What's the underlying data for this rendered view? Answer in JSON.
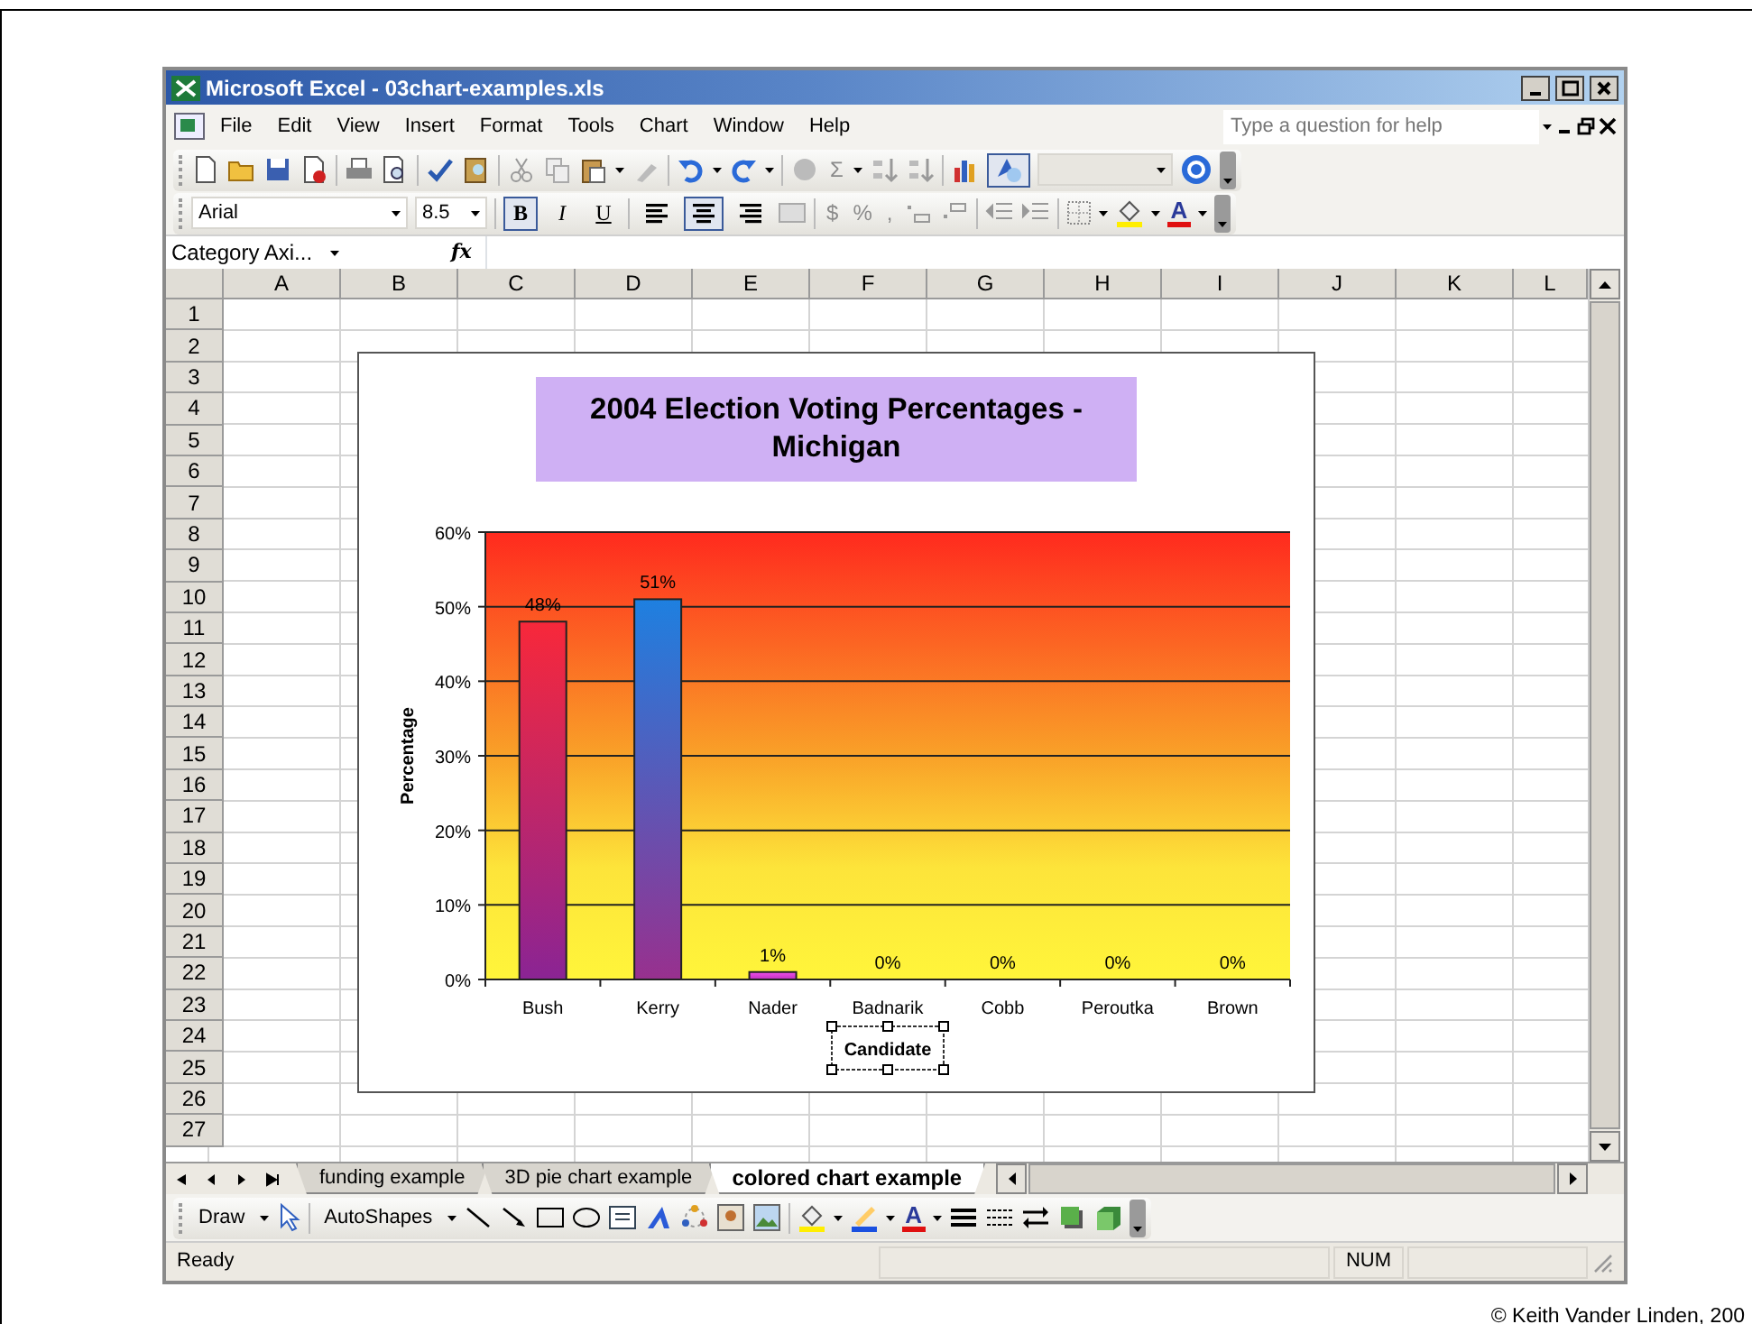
{
  "window": {
    "title": "Microsoft Excel - 03chart-examples.xls"
  },
  "menu": [
    {
      "label": "File"
    },
    {
      "label": "Edit"
    },
    {
      "label": "View"
    },
    {
      "label": "Insert"
    },
    {
      "label": "Format"
    },
    {
      "label": "Tools"
    },
    {
      "label": "Chart"
    },
    {
      "label": "Window"
    },
    {
      "label": "Help"
    }
  ],
  "help_search": {
    "placeholder": "Type a question for help"
  },
  "standard_toolbar": {
    "autosum": "Σ",
    "drawing_pressed": true
  },
  "formatting_toolbar": {
    "font": "Arial",
    "size": "8.5",
    "styles": [
      {
        "label": "B",
        "pressed": true
      },
      {
        "label": "I",
        "pressed": false
      },
      {
        "label": "U",
        "pressed": false
      }
    ],
    "alignment": [
      {
        "kind": "left",
        "pressed": false
      },
      {
        "kind": "center",
        "pressed": true
      },
      {
        "kind": "right",
        "pressed": false
      }
    ],
    "number_formats": [
      "$",
      "%",
      ","
    ],
    "font_color_glyph": "A"
  },
  "formula_bar": {
    "name_box": "Category Axi...",
    "function_label": "fx"
  },
  "sheet": {
    "columns": [
      "A",
      "B",
      "C",
      "D",
      "E",
      "F",
      "G",
      "H",
      "I",
      "J",
      "K",
      "L"
    ],
    "rows": [
      "1",
      "2",
      "3",
      "4",
      "5",
      "6",
      "7",
      "8",
      "9",
      "10",
      "11",
      "12",
      "13",
      "14",
      "15",
      "16",
      "17",
      "18",
      "19",
      "20",
      "21",
      "22",
      "23",
      "24",
      "25",
      "26",
      "27"
    ]
  },
  "chart": {
    "chart_data": {
      "type": "bar",
      "title": "2004 Election Voting Percentages - Michigan",
      "xlabel": "Candidate",
      "ylabel": "Percentage",
      "categories": [
        "Bush",
        "Kerry",
        "Nader",
        "Badnarik",
        "Cobb",
        "Peroutka",
        "Brown"
      ],
      "values": [
        48,
        51,
        1,
        0,
        0,
        0,
        0
      ],
      "ylim": [
        0,
        60
      ],
      "grid": true,
      "yticks": [
        {
          "value": 0,
          "label": "0%"
        },
        {
          "value": 10,
          "label": "10%"
        },
        {
          "value": 20,
          "label": "20%"
        },
        {
          "value": 30,
          "label": "30%"
        },
        {
          "value": 40,
          "label": "40%"
        },
        {
          "value": 50,
          "label": "50%"
        },
        {
          "value": 60,
          "label": "60%"
        }
      ],
      "value_labels": [
        "48%",
        "51%",
        "1%",
        "0%",
        "0%",
        "0%",
        "0%"
      ]
    },
    "xlabel_selected": true
  },
  "sheet_tabs": [
    {
      "label": "funding example",
      "selected": false
    },
    {
      "label": "3D pie chart example",
      "selected": false
    },
    {
      "label": "colored chart example",
      "selected": true
    }
  ],
  "drawing_toolbar": {
    "draw_menu": "Draw",
    "autoshapes_menu": "AutoShapes",
    "font_color_glyph": "A"
  },
  "status_bar": {
    "status": "Ready",
    "indicator": "NUM"
  },
  "footer": {
    "copyright": "© Keith Vander Linden, 200"
  }
}
